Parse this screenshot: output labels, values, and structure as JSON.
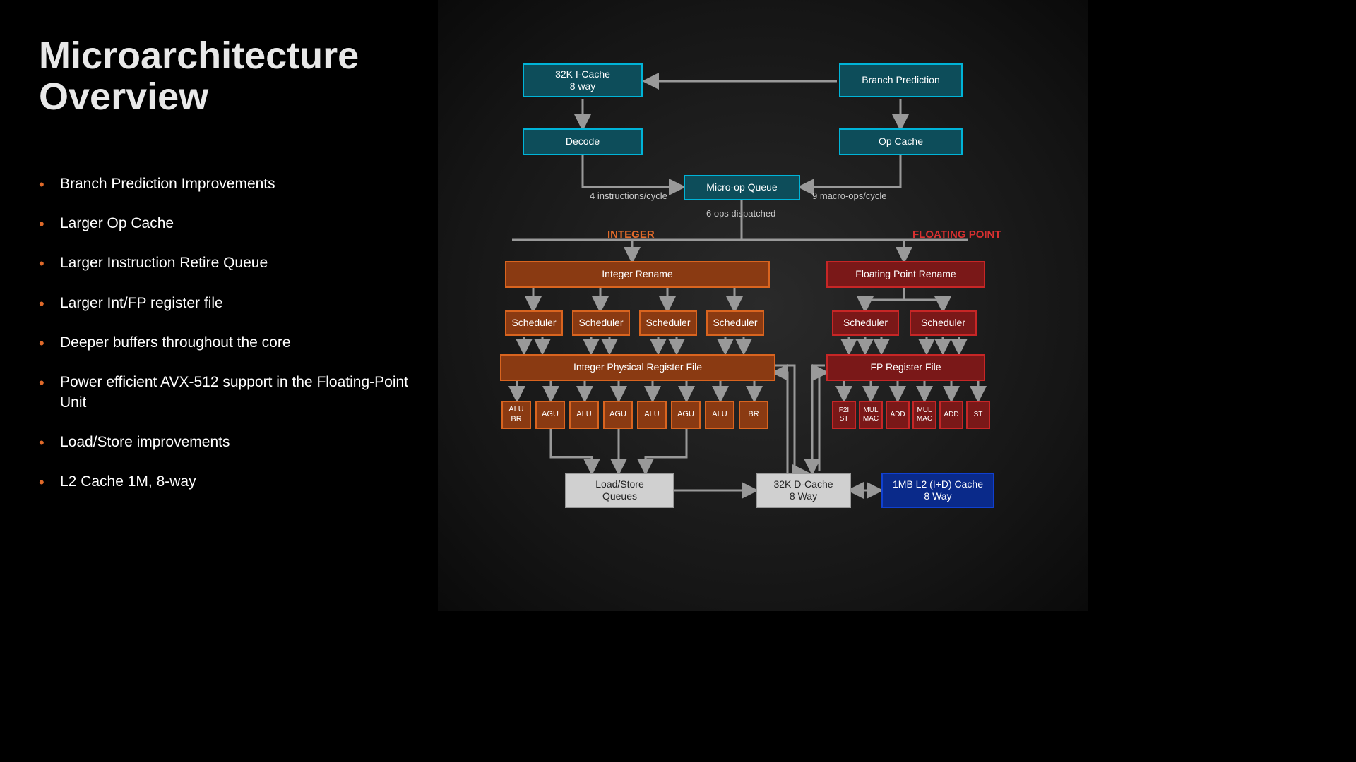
{
  "title": "Microarchitecture Overview",
  "bullets": [
    "Branch Prediction Improvements",
    "Larger Op Cache",
    "Larger Instruction Retire Queue",
    "Larger Int/FP register file",
    "Deeper buffers throughout the core",
    "Power efficient AVX-512 support in the Floating-Point Unit",
    "Load/Store improvements",
    "L2 Cache 1M, 8-way"
  ],
  "diagram": {
    "icache": "32K I-Cache\n8 way",
    "branch_pred": "Branch Prediction",
    "decode": "Decode",
    "opcache": "Op Cache",
    "microop": "Micro-op Queue",
    "label_4inst": "4 instructions/cycle",
    "label_9macro": "9 macro-ops/cycle",
    "label_6ops": "6 ops dispatched",
    "integer_label": "INTEGER",
    "fp_label": "FLOATING POINT",
    "int_rename": "Integer Rename",
    "fp_rename": "Floating Point Rename",
    "scheduler": "Scheduler",
    "int_prf": "Integer Physical Register File",
    "fp_prf": "FP Register File",
    "int_units": [
      "ALU\nBR",
      "AGU",
      "ALU",
      "AGU",
      "ALU",
      "AGU",
      "ALU",
      "BR"
    ],
    "fp_units": [
      "F2I\nST",
      "MUL\nMAC",
      "ADD",
      "MUL\nMAC",
      "ADD",
      "ST"
    ],
    "lsq": "Load/Store\nQueues",
    "dcache": "32K D-Cache\n8 Way",
    "l2": "1MB L2 (I+D) Cache\n8 Way"
  }
}
